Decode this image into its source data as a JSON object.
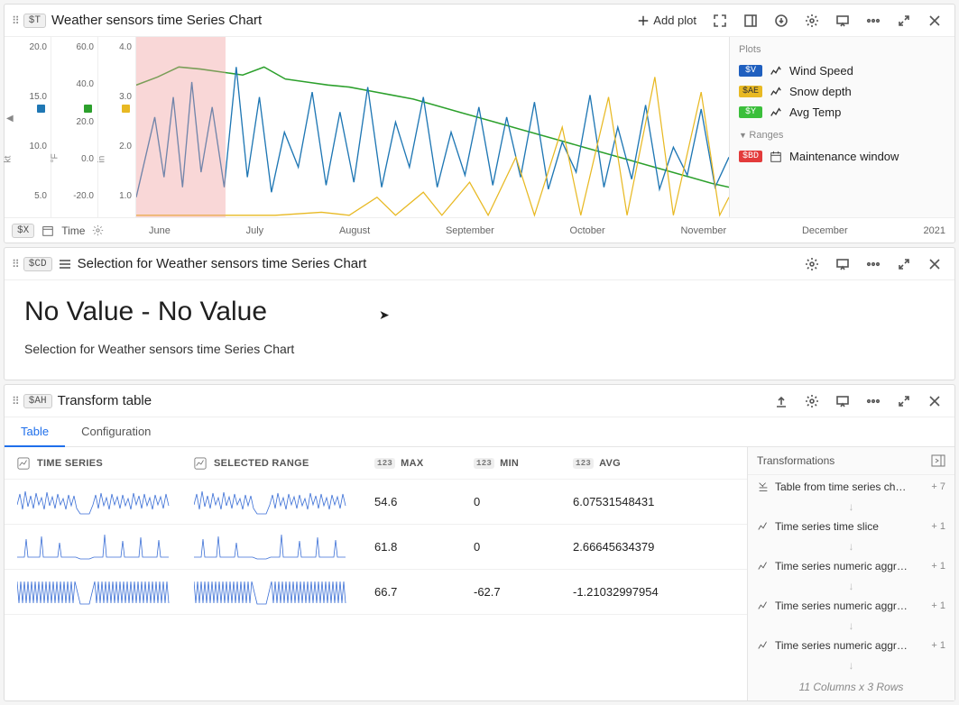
{
  "chart_panel": {
    "var": "$T",
    "title": "Weather sensors time Series Chart",
    "add_plot_label": "Add plot",
    "plots_header": "Plots",
    "ranges_header": "Ranges",
    "y_axes": [
      {
        "unit": "kt",
        "swatch": "#1f77b4",
        "ticks": [
          "20.0",
          "15.0",
          "10.0",
          "5.0"
        ]
      },
      {
        "unit": "°F",
        "swatch": "#2ca02c",
        "ticks": [
          "60.0",
          "40.0",
          "20.0",
          "0.0",
          "-20.0"
        ]
      },
      {
        "unit": "in",
        "swatch": "#e8b923",
        "ticks": [
          "4.0",
          "3.0",
          "2.0",
          "1.0"
        ]
      }
    ],
    "plots": [
      {
        "badge": "$V",
        "color": "#1f5fbf",
        "label": "Wind Speed"
      },
      {
        "badge": "$AE",
        "color": "#e8b923",
        "label": "Snow depth"
      },
      {
        "badge": "$Y",
        "color": "#3bbf3b",
        "label": "Avg Temp"
      }
    ],
    "ranges": [
      {
        "badge": "$BD",
        "color": "#e33b3b",
        "label": "Maintenance window",
        "icon": "calendar"
      }
    ],
    "x_axis": {
      "var": "$X",
      "label": "Time",
      "ticks": [
        "June",
        "July",
        "August",
        "September",
        "October",
        "November",
        "December",
        "2021"
      ]
    },
    "highlight": {
      "left_pct": 0,
      "width_pct": 15
    }
  },
  "selection_panel": {
    "var": "$CD",
    "title": "Selection for Weather sensors time Series Chart",
    "big_text": "No Value - No Value",
    "sub_text": "Selection for Weather sensors time Series Chart"
  },
  "transform_panel": {
    "var": "$AH",
    "title": "Transform table",
    "tabs": {
      "table": "Table",
      "config": "Configuration"
    },
    "columns": {
      "ts": "TIME SERIES",
      "sel": "SELECTED RANGE",
      "max": "MAX",
      "min": "MIN",
      "avg": "AVG"
    },
    "col_type": "123",
    "rows": [
      {
        "max": "54.6",
        "min": "0",
        "avg": "6.07531548431"
      },
      {
        "max": "61.8",
        "min": "0",
        "avg": "2.66645634379"
      },
      {
        "max": "66.7",
        "min": "-62.7",
        "avg": "-1.21032997954"
      }
    ],
    "transformations_header": "Transformations",
    "transformations": [
      {
        "name": "Table from time series ch…",
        "count": "+ 7"
      },
      {
        "name": "Time series time slice",
        "count": "+ 1"
      },
      {
        "name": "Time series numeric aggr…",
        "count": "+ 1"
      },
      {
        "name": "Time series numeric aggr…",
        "count": "+ 1"
      },
      {
        "name": "Time series numeric aggr…",
        "count": "+ 1"
      }
    ],
    "summary": "11 Columns x 3 Rows"
  },
  "chart_data": {
    "type": "line",
    "x": [
      "June",
      "July",
      "August",
      "September",
      "October",
      "November",
      "December",
      "2021"
    ],
    "series": [
      {
        "name": "Wind Speed",
        "unit": "kt",
        "color": "#1f77b4",
        "ylim": [
          0,
          25
        ],
        "values_est": [
          8,
          11,
          19,
          9,
          15,
          12,
          14,
          8,
          17,
          10,
          13,
          9,
          16,
          7,
          12,
          10,
          11,
          8,
          14,
          6,
          13,
          9,
          15,
          10,
          12,
          8,
          17,
          11
        ]
      },
      {
        "name": "Avg Temp",
        "unit": "°F",
        "color": "#2ca02c",
        "ylim": [
          -30,
          70
        ],
        "values_est": [
          55,
          58,
          61,
          60,
          59,
          57,
          55,
          53,
          51,
          49,
          47,
          44,
          41,
          38,
          35,
          32,
          29,
          26,
          23,
          20,
          17,
          14,
          11,
          8,
          5,
          2,
          -1,
          -4
        ]
      },
      {
        "name": "Snow depth",
        "unit": "in",
        "color": "#e8b923",
        "ylim": [
          0,
          5
        ],
        "values_est": [
          0,
          0,
          0,
          0,
          0,
          0,
          0,
          0,
          0,
          0,
          0,
          0,
          0,
          0,
          0.2,
          0,
          0.5,
          0,
          1.2,
          0.3,
          2.1,
          0.8,
          3.4,
          1.5,
          4.2,
          2.0,
          3.8,
          1.2
        ]
      }
    ],
    "ranges": [
      {
        "name": "Maintenance window",
        "color": "#e33b3b",
        "from_approx": "early June",
        "to_approx": "mid July"
      }
    ],
    "title": "Weather sensors time Series Chart",
    "xlabel": "Time"
  }
}
